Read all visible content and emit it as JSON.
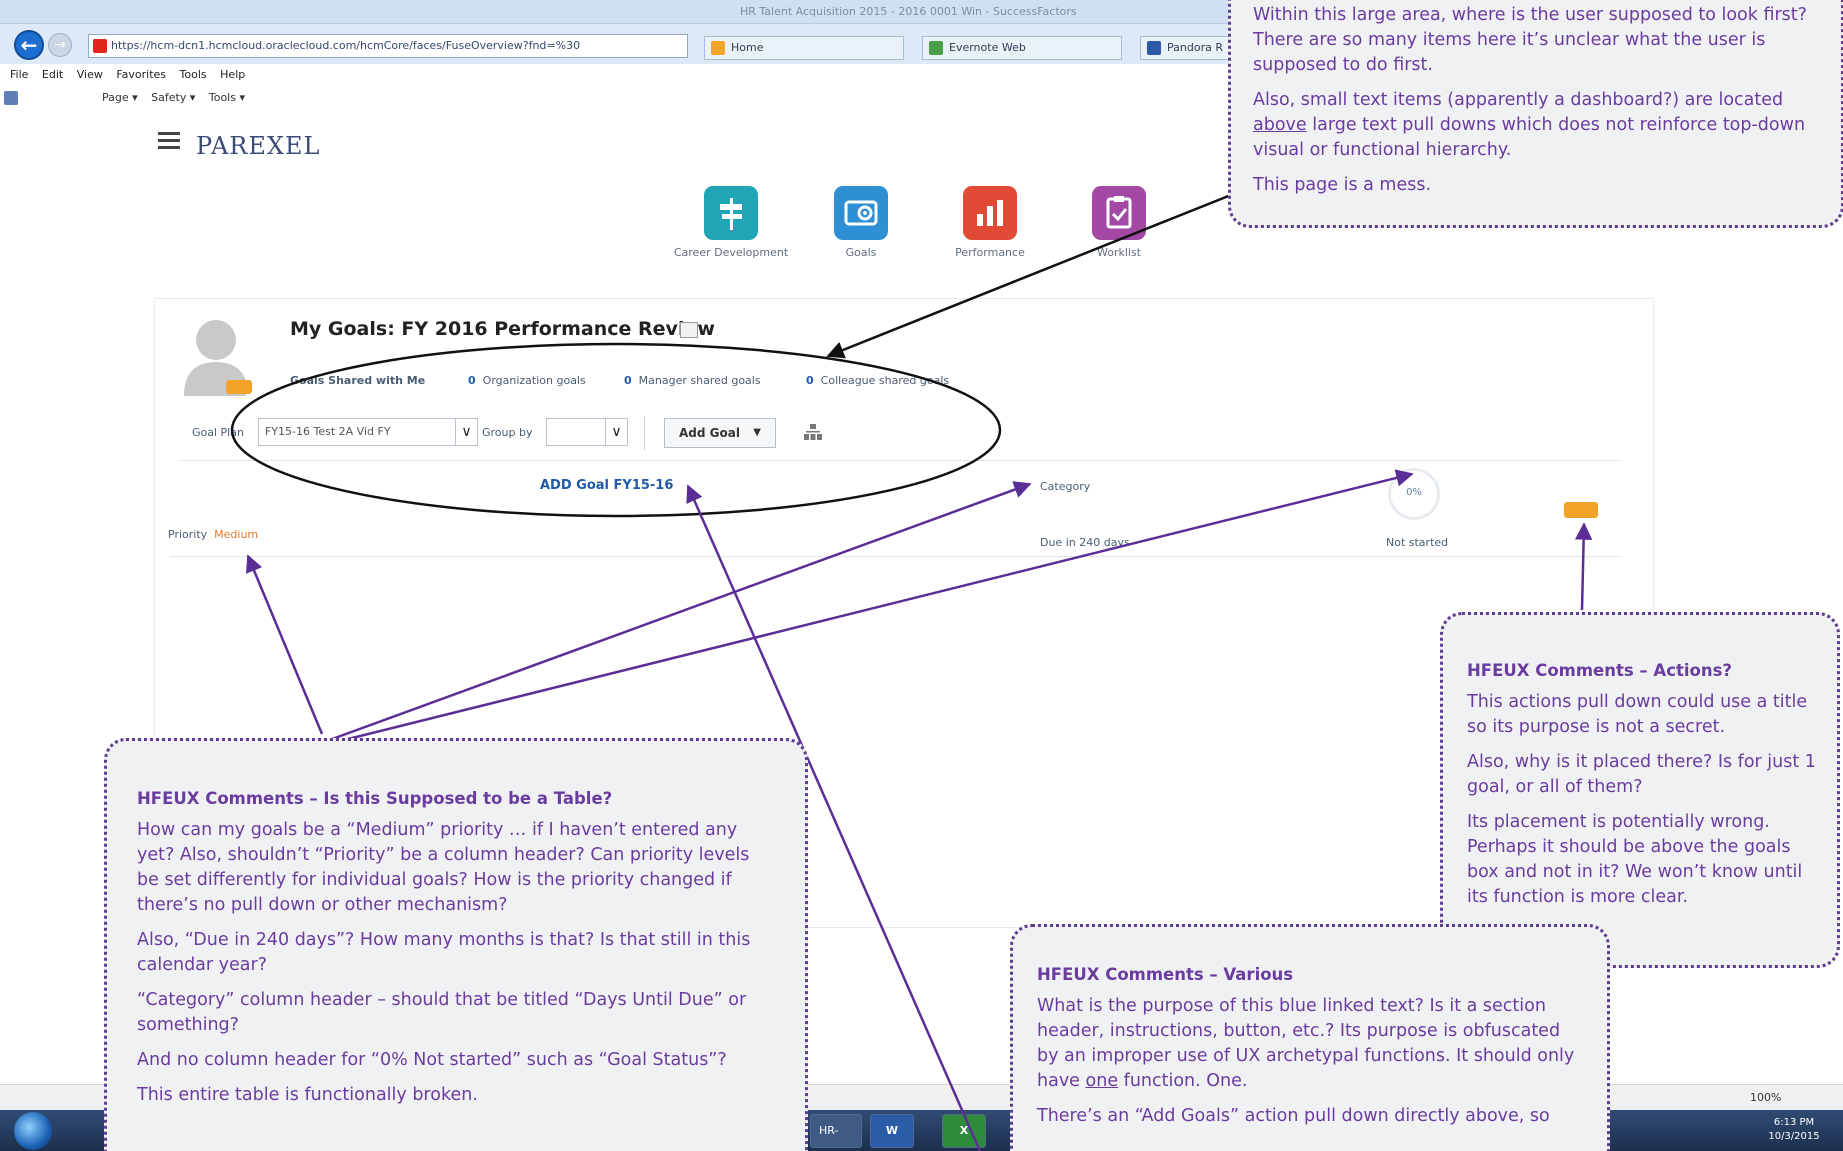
{
  "browser": {
    "window_title": "HR Talent Acquisition 2015 - 2016 0001 Win - SuccessFactors",
    "url": "https://hcm-dcn1.hcmcloud.oraclecloud.com/hcmCore/faces/FuseOverview?fnd=%30",
    "tabs": [
      {
        "label": "Home"
      },
      {
        "label": "Evernote Web"
      },
      {
        "label": "Pandora R"
      }
    ],
    "menu": [
      "File",
      "Edit",
      "View",
      "Favorites",
      "Tools",
      "Help"
    ],
    "command_bar": [
      "Page ▾",
      "Safety ▾",
      "Tools ▾"
    ],
    "zoom": "100%"
  },
  "page": {
    "brand": "PAREXEL",
    "apps": [
      {
        "label": "Career Development",
        "icon": "signpost-icon",
        "color": "#21a6b7"
      },
      {
        "label": "Goals",
        "icon": "goals-icon",
        "color": "#2e8fd4"
      },
      {
        "label": "Performance",
        "icon": "chart-icon",
        "color": "#e14a34"
      },
      {
        "label": "Worklist",
        "icon": "clipboard-icon",
        "color": "#a448a6"
      }
    ],
    "goals": {
      "title": "My Goals: FY 2016 Performance Review",
      "shared_label": "Goals Shared with Me",
      "stats": [
        {
          "count": "0",
          "label": "Organization goals"
        },
        {
          "count": "0",
          "label": "Manager shared goals"
        },
        {
          "count": "0",
          "label": "Colleague shared goals"
        }
      ],
      "goal_plan_label": "Goal Plan",
      "goal_plan_value": "FY15-16 Test 2A Vid FY",
      "group_by_label": "Group by",
      "group_by_value": "",
      "add_goal_label": "Add Goal",
      "goal_link": "ADD Goal FY15-16",
      "category_label": "Category",
      "percent": "0%",
      "priority_label": "Priority",
      "priority_value": "Medium",
      "due_text": "Due in 240 days",
      "status_text": "Not started"
    }
  },
  "taskbar": {
    "items": [
      "HR-Tal...",
      "W",
      "X"
    ],
    "time": "6:13 PM",
    "date": "10/3/2015"
  },
  "annotations": {
    "top": {
      "paragraphs": [
        "Within this large area, where is the user supposed to look first? There are so many items here it’s unclear what the user is supposed to do first.",
        "This page is a mess."
      ],
      "p2_before": "Also, small text items (apparently a dashboard?) are located ",
      "p2_underline": "above",
      "p2_after": " large text pull downs which does not reinforce top-down visual or functional hierarchy."
    },
    "table": {
      "title": "HFEUX Comments – Is this Supposed to be a Table?",
      "paragraphs": [
        "How can my goals be a “Medium” priority … if I haven’t entered any yet? Also, shouldn’t “Priority” be a column header? Can priority levels be set differently for individual goals? How is the priority  changed if there’s no pull down or other mechanism?",
        "Also, “Due in 240 days”? How many months is that? Is that still in this calendar year?",
        "“Category” column header – should that be titled “Days Until Due” or something?",
        "And no column header for “0% Not started” such as “Goal Status”?",
        "This entire table is functionally broken."
      ]
    },
    "actions": {
      "title": "HFEUX Comments – Actions?",
      "paragraphs": [
        "This actions pull down could use a title so its purpose is not a secret.",
        "Also, why is it placed there? Is for just 1 goal, or all of them?",
        "Its placement is potentially wrong. Perhaps it should be above the goals box and not in it? We won’t know until its function is more clear."
      ]
    },
    "various": {
      "title": "HFEUX Comments – Various",
      "p1": "What is the purpose of this blue linked text? Is it a section header, instructions, button, etc.? Its purpose is obfuscated by an improper use of UX archetypal functions. It should only have ",
      "p1_underline": "one",
      "p1_after": " function. One.",
      "p2": "There’s an “Add Goals” action pull down directly above, so"
    }
  }
}
